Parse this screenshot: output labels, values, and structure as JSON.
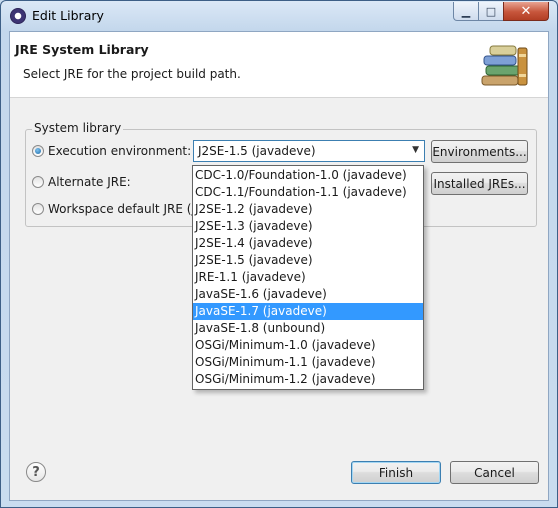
{
  "window": {
    "title": "Edit Library"
  },
  "header": {
    "title": "JRE System Library",
    "description": "Select JRE for the project build path."
  },
  "group": {
    "label": "System library",
    "options": [
      {
        "label": "Execution environment:",
        "checked": true
      },
      {
        "label": "Alternate JRE:",
        "checked": false
      },
      {
        "label": "Workspace default JRE (j",
        "checked": false
      }
    ],
    "combo_value": "J2SE-1.5 (javadeve)",
    "environments_button": "Environments...",
    "installed_jres_button": "Installed JREs..."
  },
  "dropdown": {
    "items": [
      "CDC-1.0/Foundation-1.0 (javadeve)",
      "CDC-1.1/Foundation-1.1 (javadeve)",
      "J2SE-1.2 (javadeve)",
      "J2SE-1.3 (javadeve)",
      "J2SE-1.4 (javadeve)",
      "J2SE-1.5 (javadeve)",
      "JRE-1.1 (javadeve)",
      "JavaSE-1.6 (javadeve)",
      "JavaSE-1.7 (javadeve)",
      "JavaSE-1.8 (unbound)",
      "OSGi/Minimum-1.0 (javadeve)",
      "OSGi/Minimum-1.1 (javadeve)",
      "OSGi/Minimum-1.2 (javadeve)"
    ],
    "selected_index": 8
  },
  "footer": {
    "help_icon": "?",
    "finish_button": "Finish",
    "cancel_button": "Cancel"
  },
  "colors": {
    "selection": "#3399ff",
    "title_bar": "#c9dcef",
    "close_button": "#c7563c"
  }
}
